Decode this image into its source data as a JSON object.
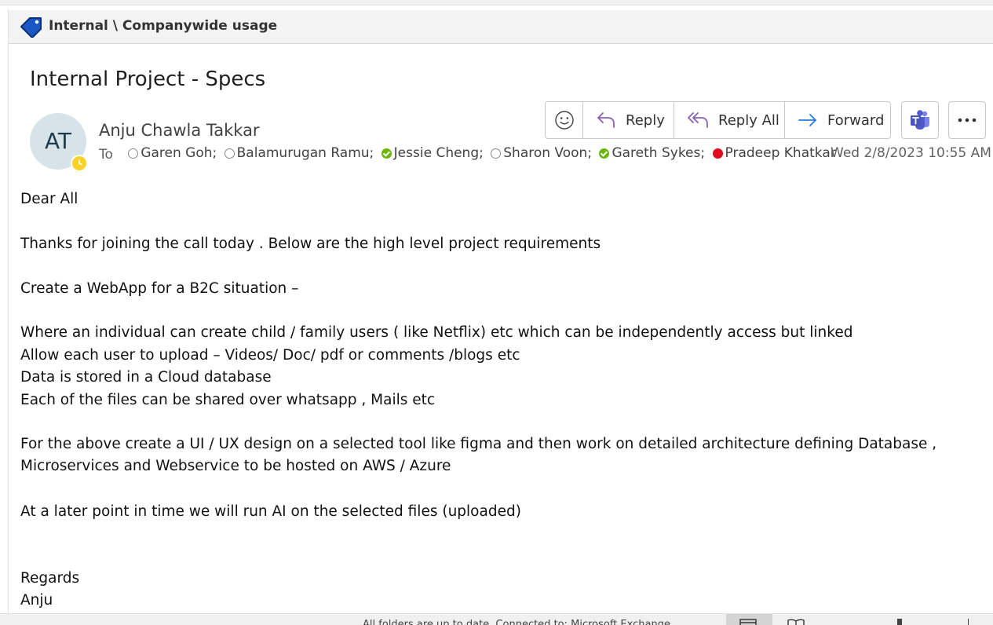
{
  "label_bar": {
    "icon": "tag-icon",
    "text": "Internal \\ Companywide usage",
    "icon_color": "#1a56c4"
  },
  "message": {
    "subject": "Internal Project - Specs",
    "sender_initials": "AT",
    "sender_name": "Anju Chawla Takkar",
    "sender_presence": "away",
    "to_label": "To",
    "recipients": [
      {
        "name": "Garen Goh;",
        "presence": "offline"
      },
      {
        "name": "Balamurugan Ramu;",
        "presence": "offline"
      },
      {
        "name": "Jessie Cheng;",
        "presence": "available"
      },
      {
        "name": "Sharon Voon;",
        "presence": "offline"
      },
      {
        "name": "Gareth Sykes;",
        "presence": "available"
      },
      {
        "name": "Pradeep Khatkar",
        "presence": "busy"
      }
    ],
    "date": "Wed 2/8/2023 10:55 AM"
  },
  "actions": {
    "emoji_icon": "smiley-icon",
    "reply_label": "Reply",
    "reply_all_label": "Reply All",
    "forward_label": "Forward",
    "teams_icon": "teams-icon",
    "more_icon": "more-icon"
  },
  "body_lines": [
    "Dear All",
    "Thanks for joining the call today . Below are the high level project requirements",
    "Create a WebApp for a B2C situation –",
    "Where an individual can create child / family users ( like Netflix) etc which can be independently access but linked",
    "Allow each user to upload – Videos/ Doc/ pdf or comments /blogs etc",
    "Data is stored in a Cloud database",
    "Each of the files can be shared over whatsapp , Mails etc",
    "For the above create a UI / UX design on a selected tool like figma and then work on detailed architecture defining Database ,",
    "Microservices and Webservice to be hosted on AWS / Azure",
    "At a later point in time we will run AI  on the selected files (uploaded)",
    "Regards",
    "Anju"
  ],
  "status_bar": {
    "text": "All folders are up to date.     Connected to: Microsoft Exchange"
  },
  "colors": {
    "accent_blue": "#1a56c4",
    "reply_purple": "#8a5fb8",
    "forward_blue": "#2b7bd8",
    "available_green": "#6bb700",
    "busy_red": "#e00b1c",
    "away_yellow": "#f8d22a"
  }
}
